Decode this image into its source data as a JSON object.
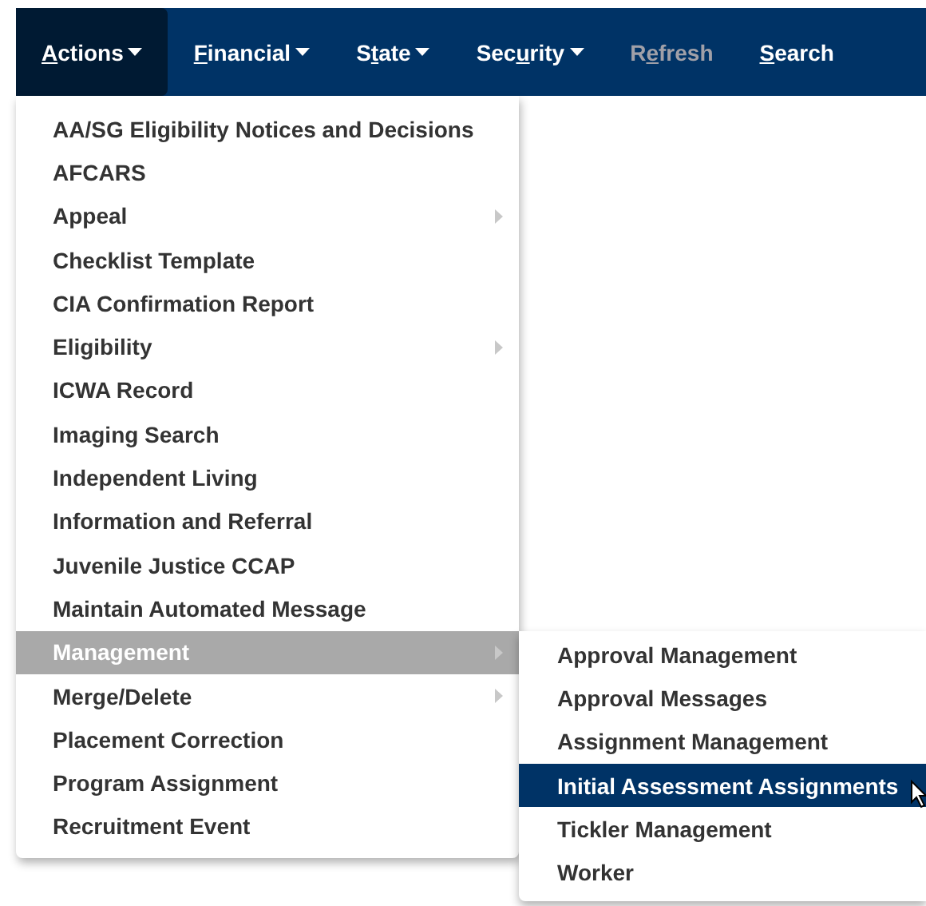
{
  "navbar": [
    {
      "key": "A",
      "post": "ctions",
      "dropdown": true,
      "selected": true,
      "disabled": false
    },
    {
      "key": "F",
      "post": "inancial",
      "dropdown": true,
      "selected": false,
      "disabled": false
    },
    {
      "pre": "S",
      "key": "t",
      "post": "ate",
      "dropdown": true,
      "selected": false,
      "disabled": false
    },
    {
      "pre": "Sec",
      "key": "u",
      "post": "rity",
      "dropdown": true,
      "selected": false,
      "disabled": false
    },
    {
      "pre": "R",
      "key": "e",
      "post": "fresh",
      "dropdown": false,
      "selected": false,
      "disabled": true
    },
    {
      "key": "S",
      "post": "earch",
      "dropdown": false,
      "selected": false,
      "disabled": false
    }
  ],
  "menu": [
    {
      "label": "AA/SG Eligibility Notices and Decisions",
      "submenu": false,
      "selected": false
    },
    {
      "label": "AFCARS",
      "submenu": false,
      "selected": false
    },
    {
      "label": "Appeal",
      "submenu": true,
      "selected": false
    },
    {
      "label": "Checklist Template",
      "submenu": false,
      "selected": false
    },
    {
      "label": "CIA Confirmation Report",
      "submenu": false,
      "selected": false
    },
    {
      "label": "Eligibility",
      "submenu": true,
      "selected": false
    },
    {
      "label": "ICWA Record",
      "submenu": false,
      "selected": false
    },
    {
      "label": "Imaging Search",
      "submenu": false,
      "selected": false
    },
    {
      "label": "Independent Living",
      "submenu": false,
      "selected": false
    },
    {
      "label": "Information and Referral",
      "submenu": false,
      "selected": false
    },
    {
      "label": "Juvenile Justice CCAP",
      "submenu": false,
      "selected": false
    },
    {
      "label": "Maintain Automated Message",
      "submenu": false,
      "selected": false
    },
    {
      "label": "Management",
      "submenu": true,
      "selected": true
    },
    {
      "label": "Merge/Delete",
      "submenu": true,
      "selected": false
    },
    {
      "label": "Placement Correction",
      "submenu": false,
      "selected": false
    },
    {
      "label": "Program Assignment",
      "submenu": false,
      "selected": false
    },
    {
      "label": "Recruitment Event",
      "submenu": false,
      "selected": false
    }
  ],
  "submenu": [
    {
      "label": "Approval Management",
      "selected": false
    },
    {
      "label": "Approval Messages",
      "selected": false
    },
    {
      "label": "Assignment Management",
      "selected": false
    },
    {
      "label": "Initial Assessment Assignments",
      "selected": true
    },
    {
      "label": "Tickler Management",
      "selected": false
    },
    {
      "label": "Worker",
      "selected": false
    }
  ]
}
